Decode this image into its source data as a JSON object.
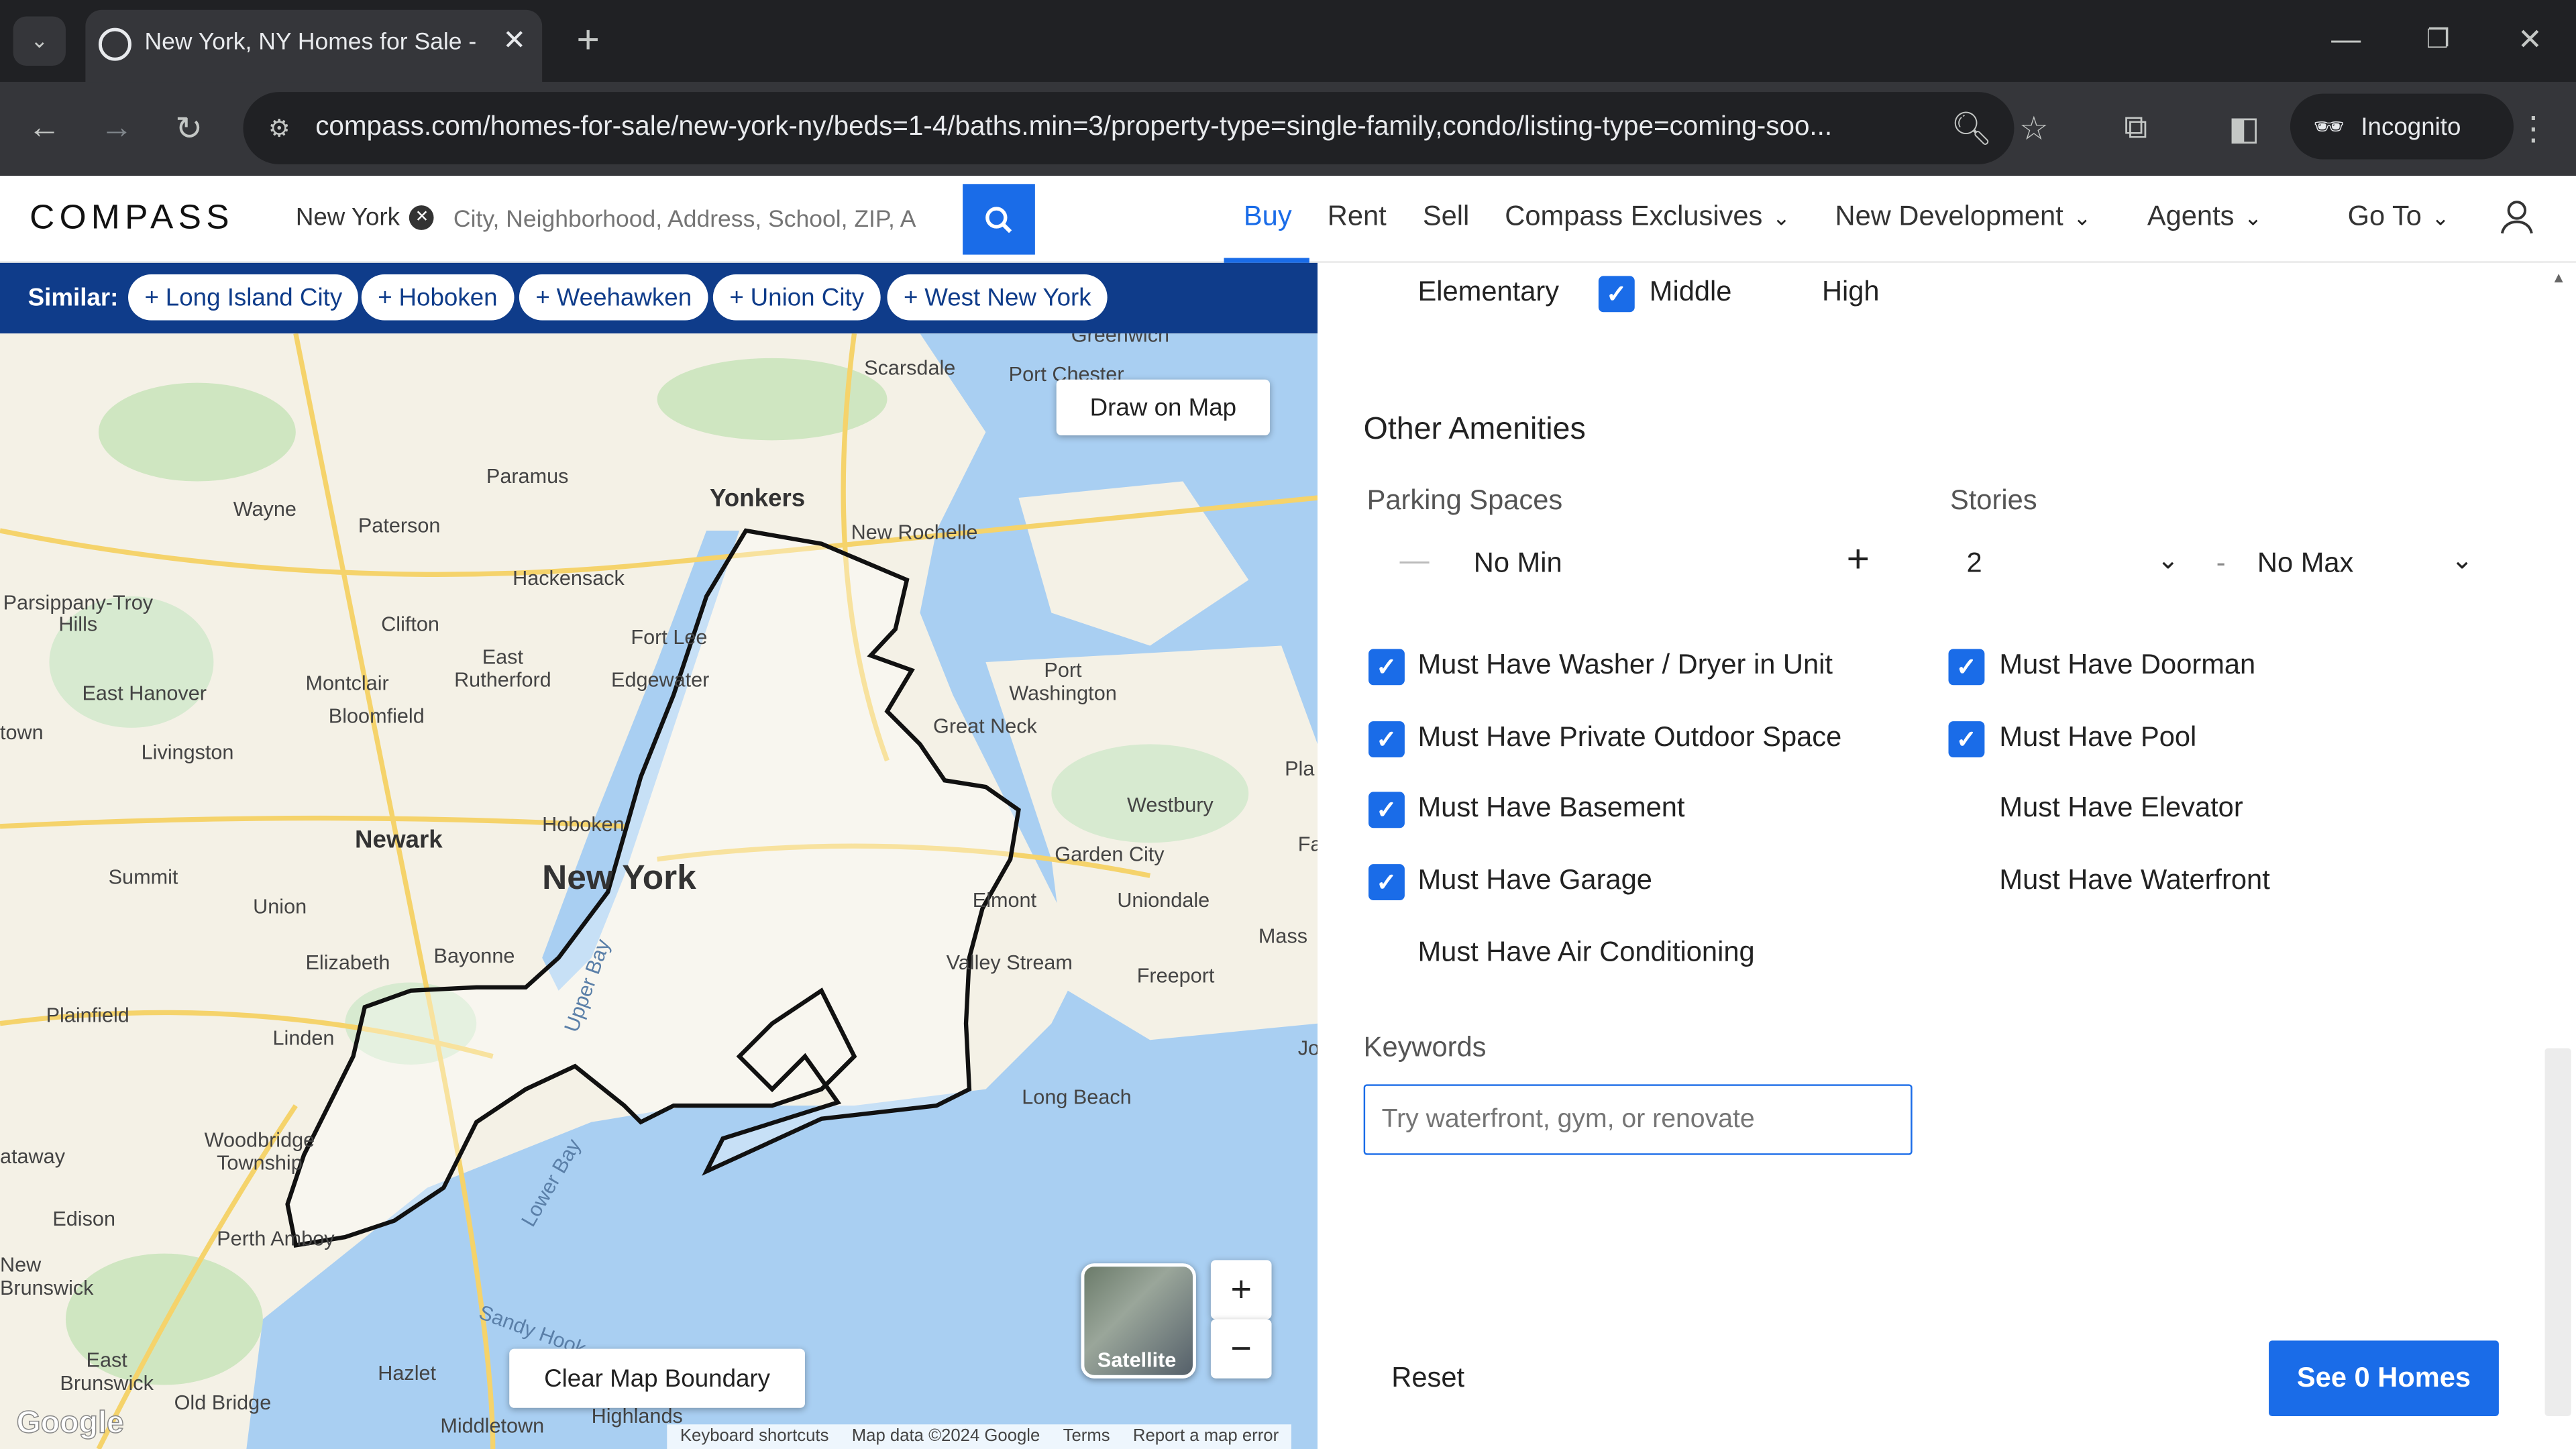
{
  "browser": {
    "tab_title": "New York, NY Homes for Sale -",
    "url": "compass.com/homes-for-sale/new-york-ny/beds=1-4/baths.min=3/property-type=single-family,condo/listing-type=coming-soo...",
    "profile": "Incognito"
  },
  "header": {
    "logo": "COMPASS",
    "location_chip": "New York",
    "search_placeholder": "City, Neighborhood, Address, School, ZIP, A",
    "nav": [
      "Buy",
      "Rent",
      "Sell",
      "Compass Exclusives",
      "New Development",
      "Agents",
      "Go To"
    ]
  },
  "similar": {
    "label": "Similar:",
    "chips": [
      "Long Island City",
      "Hoboken",
      "Weehawken",
      "Union City",
      "West New York"
    ]
  },
  "map": {
    "draw_button": "Draw on Map",
    "clear_button": "Clear Map Boundary",
    "satellite_label": "Satellite",
    "zoom_in": "+",
    "zoom_out": "−",
    "footer": [
      "Keyboard shortcuts",
      "Map data ©2024 Google",
      "Terms",
      "Report a map error"
    ],
    "google": "Google",
    "labels": [
      "Scarsdale",
      "Port Chester",
      "Paramus",
      "Wayne",
      "Paterson",
      "Yonkers",
      "New Rochelle",
      "Hackensack",
      "Parsippany-Troy Hills",
      "Clifton",
      "East Rutherford",
      "Fort Lee",
      "Edgewater",
      "Montclair",
      "Bloomfield",
      "East Hanover",
      "Livingston",
      "Port Washington",
      "Great Neck",
      "Westbury",
      "Newark",
      "Hoboken",
      "New York",
      "Summit",
      "Union",
      "Garden City",
      "Elmont",
      "Uniondale",
      "Elizabeth",
      "Bayonne",
      "Valley Stream",
      "Freeport",
      "Plainfield",
      "Linden",
      "Long Beach",
      "Woodbridge Township",
      "Perth Amboy",
      "Edison",
      "New Brunswick",
      "East Brunswick",
      "Old Bridge",
      "Hazlet",
      "Middletown",
      "Highlands",
      "Lower Bay",
      "Sandy Hook",
      "Mass",
      "Pla",
      "town",
      "ataway",
      "Upper Bay",
      "Fa",
      "Jo",
      "Greenwich"
    ]
  },
  "panel": {
    "school_levels": [
      {
        "label": "Elementary",
        "checked": false
      },
      {
        "label": "Middle",
        "checked": true
      },
      {
        "label": "High",
        "checked": false
      }
    ],
    "other_amenities_title": "Other Amenities",
    "parking_label": "Parking Spaces",
    "parking_value": "No Min",
    "stories_label": "Stories",
    "stories_min": "2",
    "stories_sep": "-",
    "stories_max": "No Max",
    "amenities_left": [
      {
        "label": "Must Have Washer / Dryer in Unit",
        "checked": true
      },
      {
        "label": "Must Have Private Outdoor Space",
        "checked": true
      },
      {
        "label": "Must Have Basement",
        "checked": true
      },
      {
        "label": "Must Have Garage",
        "checked": true
      },
      {
        "label": "Must Have Air Conditioning",
        "checked": false
      }
    ],
    "amenities_right": [
      {
        "label": "Must Have Doorman",
        "checked": true
      },
      {
        "label": "Must Have Pool",
        "checked": true
      },
      {
        "label": "Must Have Elevator",
        "checked": false
      },
      {
        "label": "Must Have Waterfront",
        "checked": false
      }
    ],
    "keywords_label": "Keywords",
    "keywords_placeholder": "Try waterfront, gym, or renovate",
    "reset": "Reset",
    "see_homes": "See 0 Homes"
  },
  "colors": {
    "accent": "#1a6ce8",
    "navy": "#0f3c8a",
    "chrome_dark": "#202124"
  }
}
